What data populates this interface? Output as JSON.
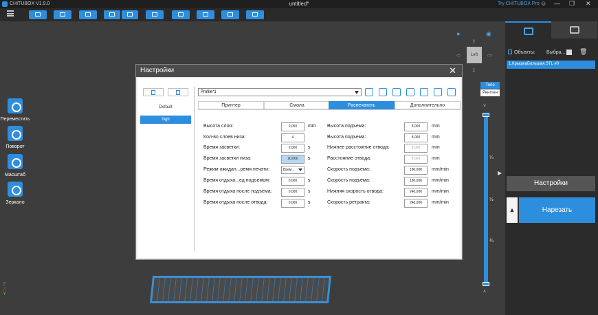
{
  "titlebar": {
    "app_name": "CHITUBOX V1.9.0",
    "document": "untitled*",
    "try_pro": "Try CHITUBOX Pro",
    "user_icon": "user-icon",
    "minimize_icon": "minimize-icon",
    "maximize_icon": "maximize-icon",
    "close_icon": "close-icon"
  },
  "left_tools": [
    {
      "label": "Переместить",
      "icon": "move-icon"
    },
    {
      "label": "Поворот",
      "icon": "rotate-icon"
    },
    {
      "label": "Масштаб",
      "icon": "scale-icon"
    },
    {
      "label": "Зеркало",
      "icon": "mirror-icon"
    }
  ],
  "axis_labels": {
    "z": "Z",
    "x": "X",
    "y": "Y"
  },
  "view": {
    "cube_label": "Left",
    "toggle_body": "Тело",
    "toggle_xray": "Рентген",
    "ticks": [
      "¼",
      "½",
      "¾"
    ]
  },
  "right_panel": {
    "objects_label": "Объекты:",
    "select_label": "Выбра...",
    "object_row": "1.КрышкаБольшая.STL #0",
    "settings_button": "Настройки",
    "slice_button": "Нарезать",
    "slice_toggle": "▲"
  },
  "dialog": {
    "title": "Настройки",
    "close": "✕",
    "profiles": [
      "Default",
      "high"
    ],
    "profile_select": "Profile*1",
    "tabs": [
      "Принтер",
      "Смола",
      "Распечатать",
      "Дополнительно"
    ],
    "active_tab": "Распечатать",
    "left_fields": [
      {
        "label": "Высота слоя:",
        "value": "0,050",
        "unit": "mm"
      },
      {
        "label": "Кол-во слоев низа:",
        "value": "4",
        "unit": ""
      },
      {
        "label": "Время засветки:",
        "value": "2,000",
        "unit": "s"
      },
      {
        "label": "Время засветки низа:",
        "value": "20,000",
        "unit": "s"
      },
      {
        "label": "Режим ожидан...ремя печати:",
        "value": "Врем...",
        "unit": ""
      },
      {
        "label": "Время отдыха...ед подъемом:",
        "value": "0,000",
        "unit": "s"
      },
      {
        "label": "Время отдыха после подъема:",
        "value": "0,000",
        "unit": "s"
      },
      {
        "label": "Время отдыха после отвода:",
        "value": "0,000",
        "unit": "s"
      }
    ],
    "right_fields": [
      {
        "label": "Высота подъема:",
        "value": "8,000",
        "unit": "mm"
      },
      {
        "label": "Высота подъема:",
        "value": "8,000",
        "unit": "mm"
      },
      {
        "label": "Нижнее расстояние отвода:",
        "value": "8,000",
        "unit": "mm"
      },
      {
        "label": "Расстояние отвода:",
        "value": "8,000",
        "unit": "mm"
      },
      {
        "label": "Скорость подъема:",
        "value": "180,000",
        "unit": "mm/min"
      },
      {
        "label": "Скорость подъема:",
        "value": "180,000",
        "unit": "mm/min"
      },
      {
        "label": "Нижняя скорость отвода:",
        "value": "240,000",
        "unit": "mm/min"
      },
      {
        "label": "Скорость ретракта:",
        "value": "240,000",
        "unit": "mm/min"
      }
    ]
  },
  "colors": {
    "accent": "#2e8ede",
    "titlebar": "#1e1e1e",
    "viewport": "#3d3d3d",
    "panel": "#2b2b2b"
  }
}
